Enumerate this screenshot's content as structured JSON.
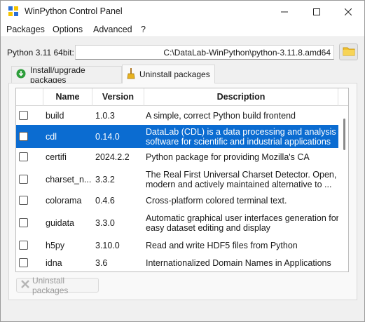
{
  "window": {
    "title": "WinPython Control Panel"
  },
  "menu": [
    "Packages",
    "Options",
    "Advanced",
    "?"
  ],
  "python": {
    "label": "Python 3.11 64bit:",
    "path": "C:\\DataLab-WinPython\\python-3.11.8.amd64"
  },
  "tabs": [
    {
      "label": "Install/upgrade packages",
      "icon": "download-arrow-icon",
      "active": false
    },
    {
      "label": "Uninstall packages",
      "icon": "broom-icon",
      "active": true
    }
  ],
  "table": {
    "columns": [
      "Name",
      "Version",
      "Description"
    ],
    "rows": [
      {
        "name": "build",
        "version": "1.0.3",
        "description": "A simple, correct Python build frontend",
        "selected": false
      },
      {
        "name": "cdl",
        "version": "0.14.0",
        "description": "DataLab (CDL) is a data processing and analysis software for scientific and industrial applications",
        "selected": true
      },
      {
        "name": "certifi",
        "version": "2024.2.2",
        "description": "Python package for providing Mozilla's CA Bundle.",
        "selected": false
      },
      {
        "name": "charset_n...",
        "version": "3.3.2",
        "description": "The Real First Universal Charset Detector. Open, modern and actively maintained alternative to ...",
        "selected": false
      },
      {
        "name": "colorama",
        "version": "0.4.6",
        "description": "Cross-platform colored terminal text.",
        "selected": false
      },
      {
        "name": "guidata",
        "version": "3.3.0",
        "description": "Automatic graphical user interfaces generation for easy dataset editing and display",
        "selected": false
      },
      {
        "name": "h5py",
        "version": "3.10.0",
        "description": "Read and write HDF5 files from Python",
        "selected": false
      },
      {
        "name": "idna",
        "version": "3.6",
        "description": "Internationalized Domain Names in Applications (IDNA)",
        "selected": false
      }
    ]
  },
  "buttons": {
    "uninstall": "Uninstall packages"
  },
  "colors": {
    "selection": "#0b6cd1",
    "accent_icon_green": "#2e9e3b",
    "folder": "#f2c230"
  }
}
